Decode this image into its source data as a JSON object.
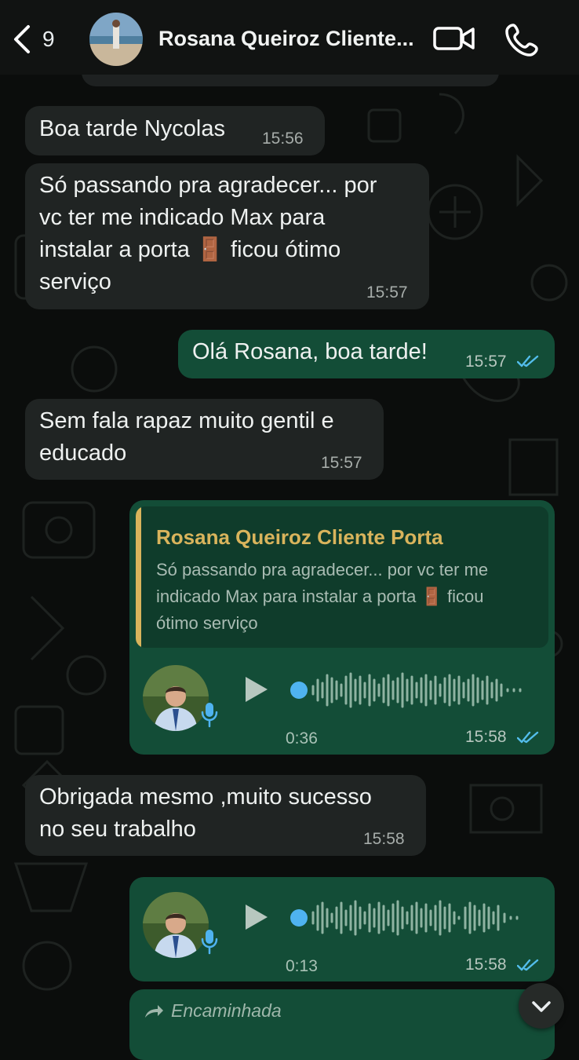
{
  "header": {
    "back_count": "9",
    "contact_name": "Rosana Queiroz Cliente...",
    "icons": [
      "chevron-left-icon",
      "video-call-icon",
      "phone-icon"
    ]
  },
  "messages": [
    {
      "type": "in",
      "text": "Boa tarde Nycolas",
      "time": "15:56"
    },
    {
      "type": "in",
      "lines": [
        "Só passando pra agradecer... por",
        "vc ter me indicado Max para",
        "instalar a porta 🚪 ficou ótimo",
        "serviço"
      ],
      "time": "15:57"
    },
    {
      "type": "out",
      "text": "Olá Rosana, boa tarde!",
      "time": "15:57",
      "status": "read"
    },
    {
      "type": "in",
      "lines": [
        "Sem fala rapaz muito gentil e",
        "educado"
      ],
      "time": "15:57"
    },
    {
      "type": "out-voice",
      "quote": {
        "name": "Rosana Queiroz Cliente Porta",
        "lines": [
          "Só passando pra agradecer... por vc ter me",
          "indicado Max para instalar a porta 🚪 ficou",
          "ótimo serviço"
        ]
      },
      "duration": "0:36",
      "time": "15:58",
      "status": "read"
    },
    {
      "type": "in",
      "lines": [
        "Obrigada mesmo ,muito sucesso",
        "no seu trabalho"
      ],
      "time": "15:58"
    },
    {
      "type": "out-voice",
      "duration": "0:13",
      "time": "15:58",
      "status": "read"
    },
    {
      "type": "out-forwarded",
      "label": "Encaminhada"
    }
  ],
  "colors": {
    "incoming": "#202423",
    "outgoing": "#134d37",
    "quote_accent": "#d9b45c",
    "read_ticks": "#53bdeb",
    "voice_dot": "#4fb3f0"
  }
}
